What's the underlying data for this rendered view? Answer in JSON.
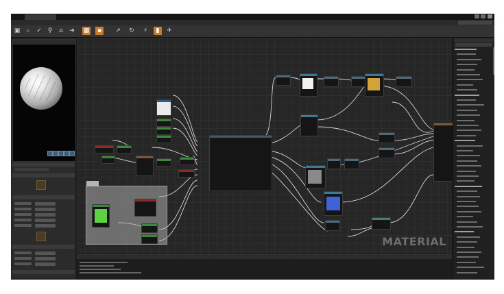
{
  "window": {
    "title_tab": "",
    "watermark": "MATERIAL"
  },
  "colors": {
    "accent": "#c97a2a",
    "graph_bg": "#262626",
    "gold_preview": "#d3a33a",
    "blue_preview": "#3f63d6",
    "green_preview": "#5ed243",
    "gray_preview": "#8a8a8a",
    "white_preview": "#f2f2f2"
  },
  "toolbar": {
    "icons": [
      "save-icon",
      "browse-icon",
      "apply-icon",
      "search-icon",
      "home-icon",
      "arrow-icon",
      "stats-icon",
      "preview-icon",
      "mobile-icon",
      "refresh-icon",
      "clean-icon",
      "highlight-icon",
      "live-icon"
    ]
  },
  "left_panel": {
    "viewport_buttons": [
      "cylinder-icon",
      "sphere-icon",
      "plane-icon",
      "cube-icon",
      "teapot-icon"
    ]
  }
}
